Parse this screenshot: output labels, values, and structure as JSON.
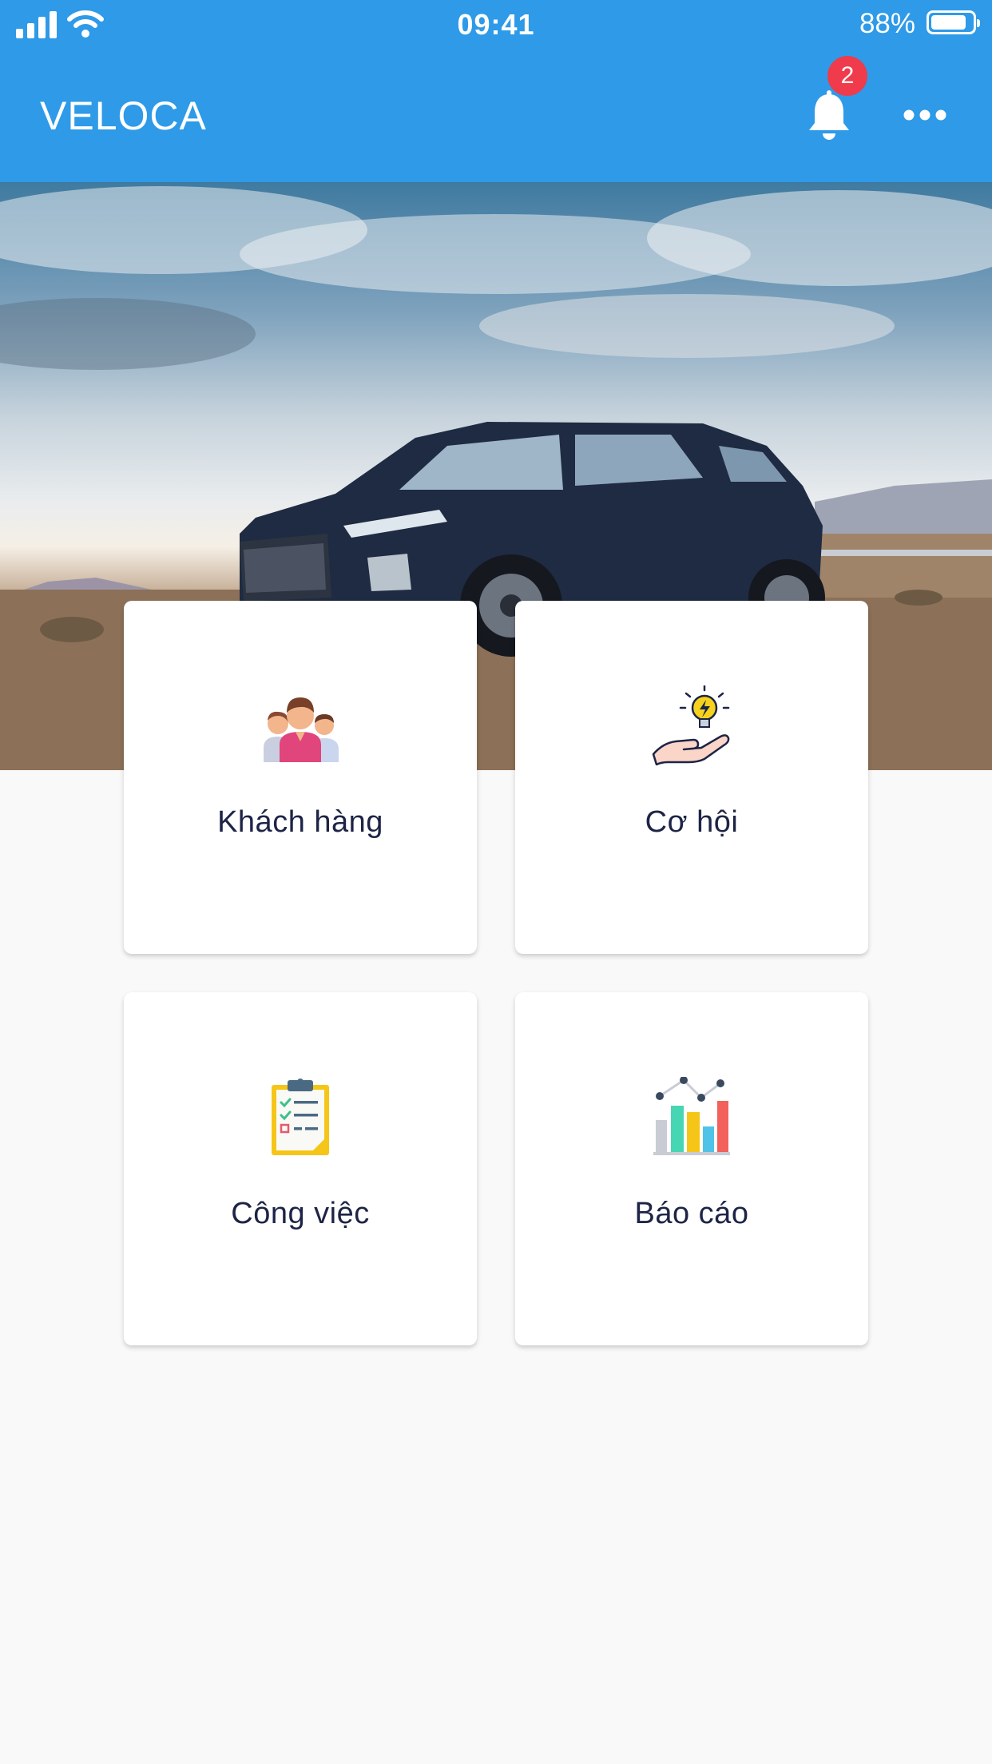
{
  "status_bar": {
    "time": "09:41",
    "battery_percent_text": "88%",
    "battery_level": 0.88
  },
  "app_bar": {
    "title": "VELOCA",
    "notification_count": "2"
  },
  "accent_color": "#2e9ae8",
  "badge_color": "#ef3b4c",
  "menu": {
    "customers": {
      "label": "Khách hàng",
      "icon": "customers-icon"
    },
    "opportunities": {
      "label": "Cơ hội",
      "icon": "opportunity-icon"
    },
    "tasks": {
      "label": "Công việc",
      "icon": "task-clipboard-icon"
    },
    "reports": {
      "label": "Báo cáo",
      "icon": "report-chart-icon"
    }
  }
}
